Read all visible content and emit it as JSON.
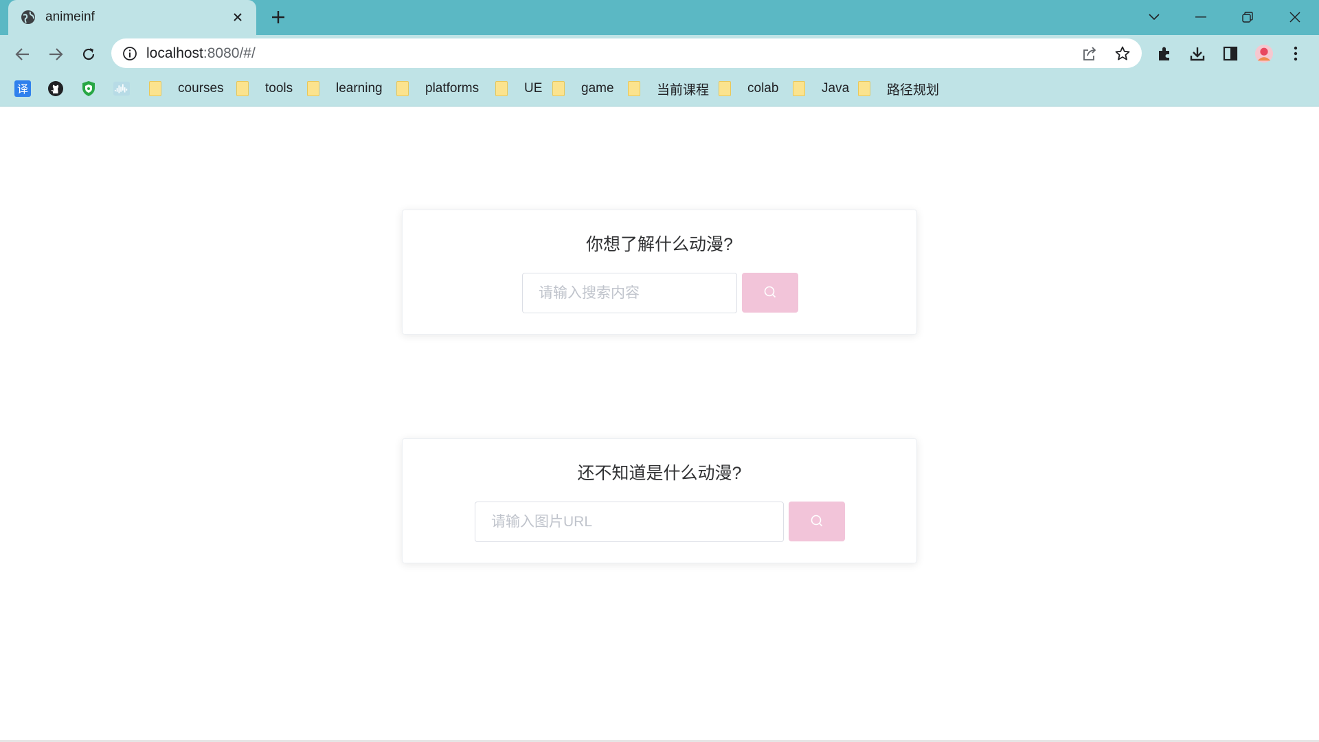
{
  "browser": {
    "tab_title": "animeinf",
    "url_host": "localhost",
    "url_rest": ":8080/#/",
    "bookmarks": [
      "courses",
      "tools",
      "learning",
      "platforms",
      "UE",
      "game",
      "当前课程",
      "colab",
      "Java",
      "路径规划"
    ]
  },
  "colors": {
    "chrome_teal": "#5bb8c4",
    "chrome_light": "#bfe3e6",
    "button_pink": "#f2c4d9"
  },
  "search_card": {
    "title": "你想了解什么动漫?",
    "placeholder": "请输入搜索内容",
    "button_icon": "search-icon"
  },
  "image_card": {
    "title": "还不知道是什么动漫?",
    "placeholder": "请输入图片URL",
    "button_icon": "search-icon"
  }
}
